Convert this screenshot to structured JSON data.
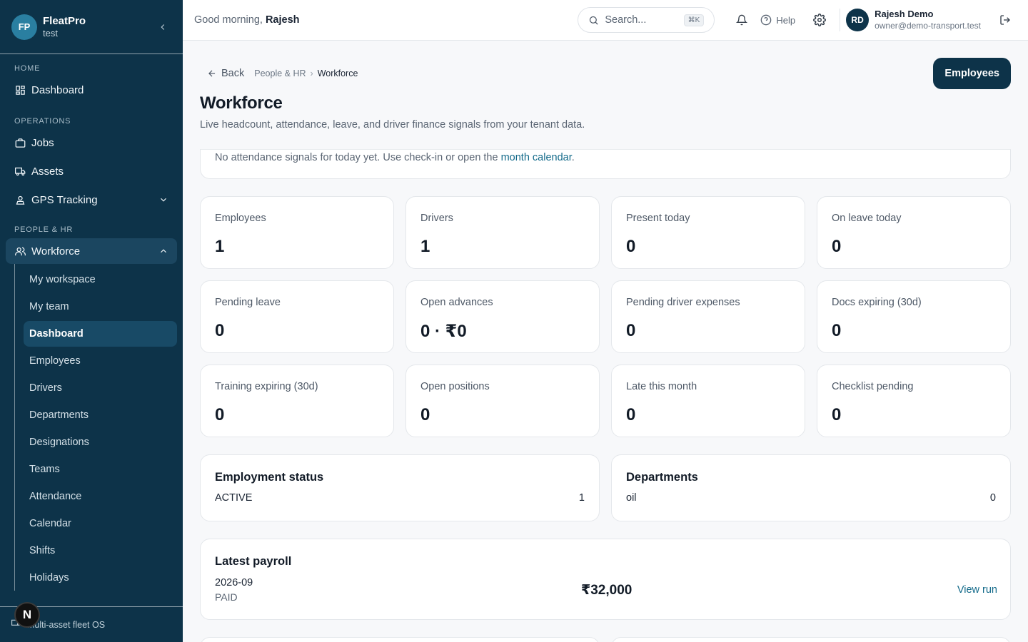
{
  "brand": {
    "initials": "FP",
    "name": "FleatPro",
    "tenant": "test"
  },
  "sidebar": {
    "sections": {
      "home": "HOME",
      "operations": "OPERATIONS",
      "people": "PEOPLE & HR"
    },
    "items": {
      "dashboard": "Dashboard",
      "jobs": "Jobs",
      "assets": "Assets",
      "gps": "GPS Tracking",
      "workforce": "Workforce"
    },
    "workforce_sub": [
      "My workspace",
      "My team",
      "Dashboard",
      "Employees",
      "Drivers",
      "Departments",
      "Designations",
      "Teams",
      "Attendance",
      "Calendar",
      "Shifts",
      "Holidays"
    ],
    "active_sub": "Dashboard",
    "footer": "Multi-asset fleet OS",
    "badge": "N"
  },
  "topbar": {
    "greeting_prefix": "Good morning,",
    "greeting_name": "Rajesh",
    "search_placeholder": "Search...",
    "search_shortcut": "⌘K",
    "help": "Help",
    "user": {
      "initials": "RD",
      "name": "Rajesh Demo",
      "email": "owner@demo-transport.test"
    }
  },
  "page": {
    "back": "Back",
    "breadcrumb": [
      "People & HR",
      "Workforce"
    ],
    "title": "Workforce",
    "description": "Live headcount, attendance, leave, and driver finance signals from your tenant data.",
    "primary_button": "Employees",
    "notice_text": "No attendance signals for today yet. Use check-in or open the",
    "notice_link": "month calendar",
    "notice_end": "."
  },
  "stats": [
    {
      "label": "Employees",
      "value": "1"
    },
    {
      "label": "Drivers",
      "value": "1"
    },
    {
      "label": "Present today",
      "value": "0"
    },
    {
      "label": "On leave today",
      "value": "0"
    },
    {
      "label": "Pending leave",
      "value": "0"
    },
    {
      "label": "Open advances",
      "value": "0 · ₹0"
    },
    {
      "label": "Pending driver expenses",
      "value": "0"
    },
    {
      "label": "Docs expiring (30d)",
      "value": "0"
    },
    {
      "label": "Training expiring (30d)",
      "value": "0"
    },
    {
      "label": "Open positions",
      "value": "0"
    },
    {
      "label": "Late this month",
      "value": "0"
    },
    {
      "label": "Checklist pending",
      "value": "0"
    }
  ],
  "employment_status": {
    "title": "Employment status",
    "rows": [
      {
        "label": "ACTIVE",
        "value": "1"
      }
    ]
  },
  "departments": {
    "title": "Departments",
    "rows": [
      {
        "label": "oil",
        "value": "0"
      }
    ]
  },
  "payroll": {
    "title": "Latest payroll",
    "period": "2026-09",
    "status": "PAID",
    "amount": "₹32,000",
    "link": "View run"
  }
}
